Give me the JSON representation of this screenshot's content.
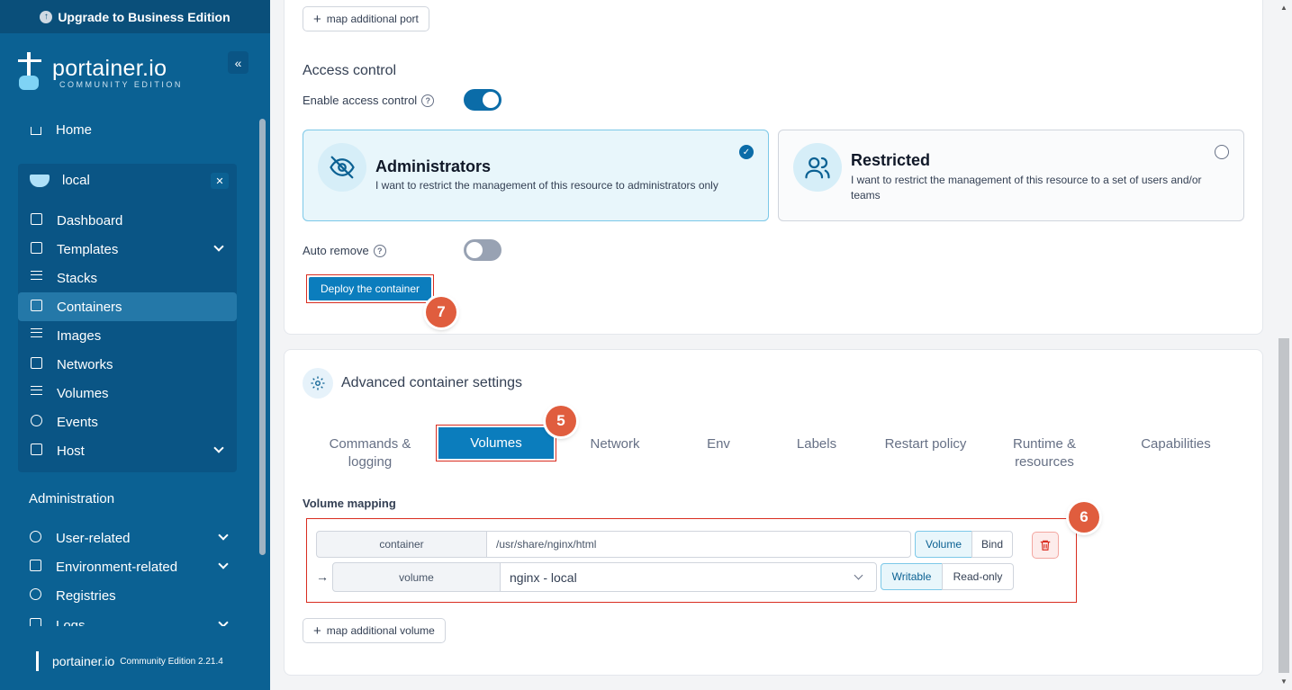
{
  "upgrade_banner": "Upgrade to Business Edition",
  "logo": {
    "name": "portainer.io",
    "edition": "COMMUNITY EDITION"
  },
  "sidebar": {
    "home": "Home",
    "environment": {
      "name": "local",
      "items": [
        "Dashboard",
        "Templates",
        "Stacks",
        "Containers",
        "Images",
        "Networks",
        "Volumes",
        "Events",
        "Host"
      ],
      "active": "Containers"
    },
    "administration_title": "Administration",
    "admin_items": [
      "User-related",
      "Environment-related",
      "Registries",
      "Logs"
    ],
    "footer": {
      "name": "portainer.io",
      "version": "Community Edition 2.21.4"
    }
  },
  "ports": {
    "add_button": "map additional port"
  },
  "access_control": {
    "title": "Access control",
    "enable_label": "Enable access control",
    "enabled": true,
    "options": [
      {
        "title": "Administrators",
        "description": "I want to restrict the management of this resource to administrators only",
        "selected": true
      },
      {
        "title": "Restricted",
        "description": "I want to restrict the management of this resource to a set of users and/or teams",
        "selected": false
      }
    ],
    "auto_remove_label": "Auto remove",
    "auto_remove": false,
    "deploy_button": "Deploy the container"
  },
  "advanced": {
    "title": "Advanced container settings",
    "tabs": [
      "Commands & logging",
      "Volumes",
      "Network",
      "Env",
      "Labels",
      "Restart policy",
      "Runtime & resources",
      "Capabilities"
    ],
    "active_tab": "Volumes",
    "volume_mapping": {
      "label": "Volume mapping",
      "container_addon": "container",
      "container_path": "/usr/share/nginx/html",
      "type_options": [
        "Volume",
        "Bind"
      ],
      "type_selected": "Volume",
      "volume_addon": "volume",
      "volume_selected": "nginx - local",
      "mode_options": [
        "Writable",
        "Read-only"
      ],
      "mode_selected": "Writable",
      "add_button": "map additional volume"
    }
  },
  "annotations": {
    "step5": "5",
    "step6": "6",
    "step7": "7"
  },
  "colors": {
    "sidebar": "#0b6193",
    "accent": "#0b7dbd",
    "highlight": "#d92d20",
    "badge": "#e05d3e"
  }
}
